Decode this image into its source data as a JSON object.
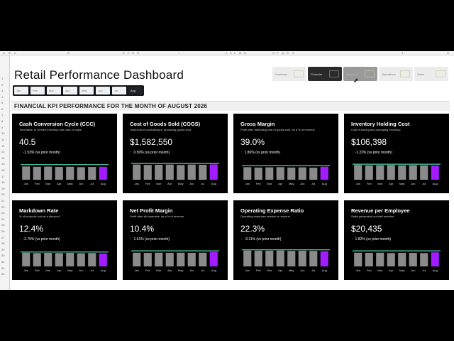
{
  "sheet": {
    "columns": [
      "A",
      "B",
      "C",
      "D",
      "E",
      "F",
      "G",
      "H",
      "I",
      "J",
      "K",
      "L",
      "M",
      "N",
      "O",
      "P",
      "Q",
      "R",
      "S",
      "T",
      "U"
    ],
    "rows": [
      "1",
      "2",
      "3",
      "4",
      "5",
      "6",
      "7",
      "8",
      "9",
      "10",
      "11",
      "12",
      "13",
      "14",
      "15",
      "16",
      "17",
      "18",
      "19",
      "20",
      "21",
      "22",
      "23",
      "24",
      "25",
      "26",
      "27",
      "28",
      "29",
      "30",
      "31",
      "32",
      "33"
    ]
  },
  "title": "Retail Performance Dashboard",
  "months": [
    "Jan",
    "Feb",
    "Mar",
    "Apr",
    "May",
    "Jun",
    "Jul",
    "Aug"
  ],
  "selected_month": "Aug",
  "nav": [
    {
      "label": "Customer",
      "state": "normal"
    },
    {
      "label": "Financial",
      "state": "active"
    },
    {
      "label": "Inventory",
      "state": "hover"
    },
    {
      "label": "Operations",
      "state": "normal"
    },
    {
      "label": "Sales",
      "state": "normal"
    }
  ],
  "section_title": "FINANCIAL KPI PERFORMANCE FOR THE MONTH OF AUGUST 2026",
  "colors": {
    "bar": "#8a8a8a",
    "highlight": "#a21cff",
    "line": "#4fd6b0",
    "card": "#000000"
  },
  "cards": [
    {
      "title": "Cash Conversion Cycle (CCC)",
      "subtitle": "Time taken to convert inventory into cash, in days",
      "value": "40.5",
      "direction": "down",
      "change": "-1.53% (vs prior month)",
      "bars": [
        0.72,
        0.7,
        0.71,
        0.69,
        0.7,
        0.68,
        0.69,
        0.7
      ],
      "target": 0.82
    },
    {
      "title": "Cost of Goods Sold (COGS)",
      "subtitle": "Total cost of purchasing or producing goods sold",
      "value": "$1,582,550",
      "direction": "up",
      "change": "0.50% (vs prior month)",
      "bars": [
        0.82,
        0.8,
        0.81,
        0.82,
        0.8,
        0.82,
        0.81,
        0.83
      ],
      "target": 0.88
    },
    {
      "title": "Gross Margin",
      "subtitle": "Profit after deducting cost of goods sold, as a % of revenue",
      "value": "39.0%",
      "direction": "up",
      "change": "1.86% (vs prior month)",
      "bars": [
        0.68,
        0.66,
        0.67,
        0.68,
        0.66,
        0.67,
        0.65,
        0.7
      ],
      "target": 0.76
    },
    {
      "title": "Inventory Holding Cost",
      "subtitle": "Cost of storing and managing inventory",
      "value": "$106,398",
      "direction": "down",
      "change": "-1.22% (vs prior month)",
      "bars": [
        0.8,
        0.78,
        0.79,
        0.8,
        0.78,
        0.79,
        0.78,
        0.77
      ],
      "target": 0.84
    },
    {
      "title": "Markdown Rate",
      "subtitle": "% of products sold at a discount",
      "value": "12.4%",
      "direction": "down",
      "change": "-2.75% (vs prior month)",
      "bars": [
        0.74,
        0.72,
        0.73,
        0.72,
        0.73,
        0.71,
        0.72,
        0.7
      ],
      "target": 0.78
    },
    {
      "title": "Net Profit Margin",
      "subtitle": "Profit after all expenses, as a % of revenue",
      "value": "10.4%",
      "direction": "up",
      "change": "1.61% (vs prior month)",
      "bars": [
        0.74,
        0.73,
        0.74,
        0.73,
        0.74,
        0.73,
        0.74,
        0.78
      ],
      "target": 0.84
    },
    {
      "title": "Operating Expense Ratio",
      "subtitle": "Operating expenses relative to revenue",
      "value": "22.3%",
      "direction": "down",
      "change": "-3.11% (vs prior month)",
      "bars": [
        0.86,
        0.85,
        0.85,
        0.86,
        0.84,
        0.85,
        0.84,
        0.82
      ],
      "target": 0.9
    },
    {
      "title": "Revenue per Employee",
      "subtitle": "Sales generated per staff member",
      "value": "$20,435",
      "direction": "up",
      "change": "1.82% (vs prior month)",
      "bars": [
        0.74,
        0.73,
        0.74,
        0.72,
        0.73,
        0.73,
        0.72,
        0.76
      ],
      "target": 0.84
    }
  ]
}
